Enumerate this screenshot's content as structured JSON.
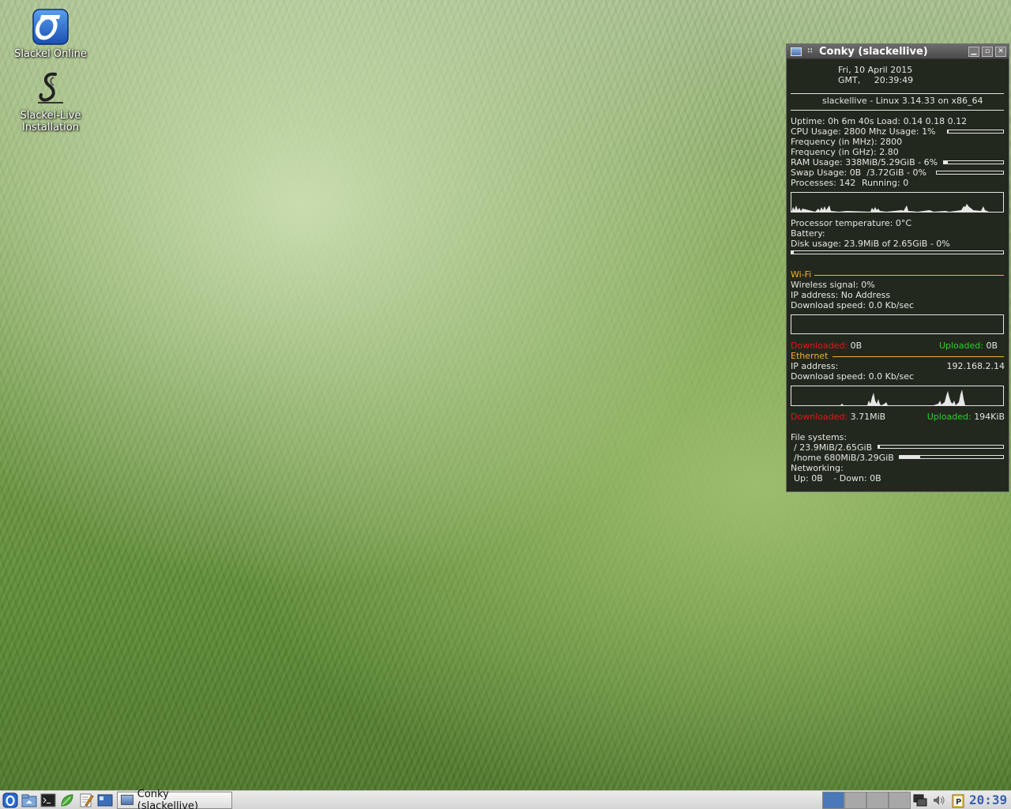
{
  "desktop": {
    "icons": [
      {
        "label": "Slackel Online",
        "icon": "slackel-online-icon"
      },
      {
        "label": "Slackel-Live\nInstallation",
        "icon": "slackel-installer-icon"
      }
    ]
  },
  "conky": {
    "window_title": "Conky (slackellive)",
    "date_line": "Fri,  10 April 2015",
    "time_line": "GMT,     20:39:49",
    "system_line": "slackellive - Linux 3.14.33 on x86_64",
    "uptime_label": "Uptime:",
    "uptime_value": "0h 6m 40s",
    "load_label": "Load:",
    "load_value": "0.14 0.18 0.12",
    "cpu_label": "CPU Usage:",
    "cpu_mhz": "2800 Mhz",
    "cpu_usage_label": "Usage:",
    "cpu_usage_value": "1%",
    "cpu_usage_fraction": 0.01,
    "freq_mhz_label": "Frequency (in MHz):",
    "freq_mhz_value": "2800",
    "freq_ghz_label": "Frequency (in GHz):",
    "freq_ghz_value": "2.80",
    "ram_label": "RAM Usage:",
    "ram_value": "338MiB/5.29GiB - 6%",
    "ram_fraction": 0.06,
    "swap_label": "Swap Usage:",
    "swap_value": "0B  /3.72GiB - 0%",
    "swap_fraction": 0.0,
    "processes_label": "Processes:",
    "processes_value": "142",
    "running_label": "Running:",
    "running_value": "0",
    "temp_label": "Processor temperature:",
    "temp_value": "0°C",
    "battery_label": "Battery:",
    "disk_label": "Disk usage:",
    "disk_value": "23.9MiB of 2.65GiB - 0%",
    "disk_fraction": 0.01,
    "wifi_header": "Wi-Fi",
    "wireless_label": "Wireless signal:",
    "wireless_value": "0%",
    "wifi_ip_label": "IP address:",
    "wifi_ip_value": "No Address",
    "wifi_dl_label": "Download speed:",
    "wifi_dl_value": "0.0 Kb/sec",
    "wifi_downloaded_label": "Downloaded:",
    "wifi_downloaded_value": "0B",
    "wifi_uploaded_label": "Uploaded:",
    "wifi_uploaded_value": "0B",
    "eth_header": "Ethernet",
    "eth_ip_label": "IP address:",
    "eth_ip_value": "192.168.2.14",
    "eth_dl_label": "Download speed:",
    "eth_dl_value": "0.0 Kb/sec",
    "eth_downloaded_label": "Downloaded:",
    "eth_downloaded_value": "3.71MiB",
    "eth_uploaded_label": "Uploaded:",
    "eth_uploaded_value": "194KiB",
    "fs_label": "File systems:",
    "fs_root": "/ 23.9MiB/2.65GiB",
    "fs_root_fraction": 0.01,
    "fs_home": "/home 680MiB/3.29GiB",
    "fs_home_fraction": 0.2,
    "networking_label": "Networking:",
    "net_up_label": "Up:",
    "net_up_value": "0B",
    "net_down_label": "- Down:",
    "net_down_value": "0B"
  },
  "taskbar": {
    "launchers": [
      "slackel-menu-icon",
      "home-folder-icon",
      "terminal-icon",
      "leaf-icon",
      "text-editor-icon",
      "show-desktop-icon"
    ],
    "task_button_label": "Conky (slackellive)",
    "clock": "20:39"
  },
  "colors": {
    "section_header": "#f0b030",
    "downloaded": "#e01818",
    "uploaded": "#2bd12b",
    "conky_bg": "#22281d"
  }
}
